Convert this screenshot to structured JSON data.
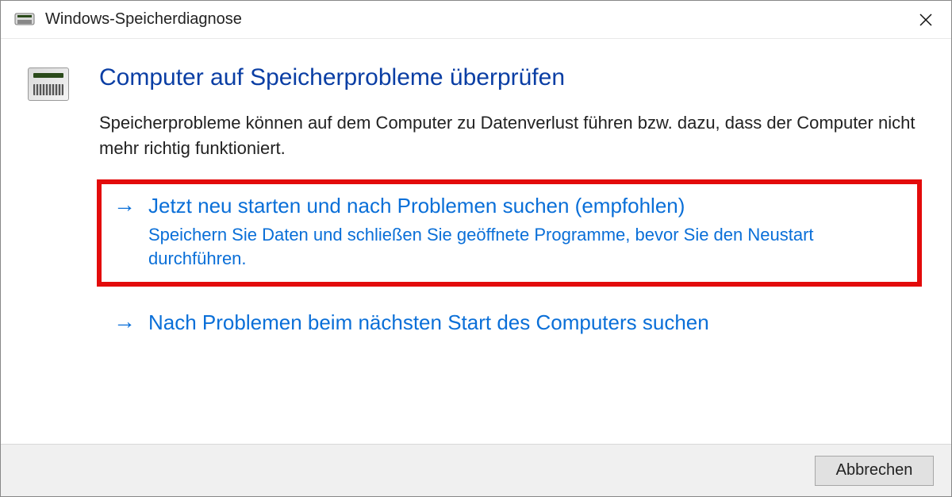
{
  "window": {
    "title": "Windows-Speicherdiagnose"
  },
  "main": {
    "heading": "Computer auf Speicherprobleme überprüfen",
    "description": "Speicherprobleme können auf dem Computer zu Datenverlust führen bzw. dazu, dass der Computer nicht mehr richtig funktioniert."
  },
  "options": {
    "restart_now": {
      "title": "Jetzt neu starten und nach Problemen suchen (empfohlen)",
      "subtitle": "Speichern Sie Daten und schließen Sie geöffnete Programme, bevor Sie den Neustart durchführen."
    },
    "check_later": {
      "title": "Nach Problemen beim nächsten Start des Computers suchen"
    }
  },
  "footer": {
    "cancel_label": "Abbrechen"
  }
}
